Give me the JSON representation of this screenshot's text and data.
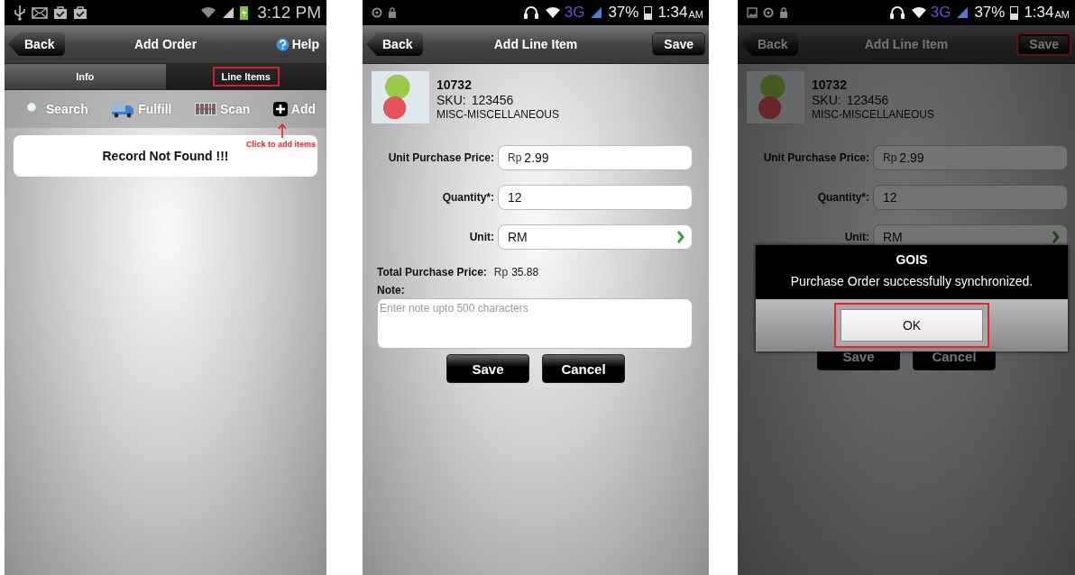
{
  "screens": [
    {
      "kind": "add_order",
      "status_bar": {
        "kind": "charging",
        "time": "3:12 PM"
      },
      "header": {
        "back": "Back",
        "title": "Add Order",
        "help": "Help"
      },
      "tabs": [
        {
          "label": "Info",
          "selected": false,
          "highlighted": false
        },
        {
          "label": "Line Items",
          "selected": true,
          "highlighted": true
        }
      ],
      "toolbar": [
        {
          "kind": "search",
          "label": "Search"
        },
        {
          "kind": "fulfill",
          "label": "Fulfill"
        },
        {
          "kind": "scan",
          "label": "Scan"
        },
        {
          "kind": "add",
          "label": "Add"
        }
      ],
      "annotation": "Click to add items",
      "message": "Record Not Found !!!"
    },
    {
      "kind": "line_item",
      "dimmed": false,
      "status_bar": {
        "kind": "headset",
        "network": "3G",
        "battery": "37%",
        "time": "1:34",
        "ampm": "AM"
      },
      "header": {
        "back": "Back",
        "title": "Add Line Item",
        "action": "Save",
        "action_highlighted": false
      },
      "product": {
        "code": "10732",
        "sku_label": "SKU:",
        "sku": "123456",
        "category": "MISC-MISCELLANEOUS"
      },
      "fields": [
        {
          "kind": "text",
          "label": "Unit Purchase Price:",
          "currency": "Rp",
          "value": "2.99"
        },
        {
          "kind": "text",
          "label": "Quantity*:",
          "value": "12"
        },
        {
          "kind": "select",
          "label": "Unit:",
          "value": "RM"
        }
      ],
      "total": {
        "label": "Total Purchase Price:",
        "currency": "Rp",
        "value": "35.88"
      },
      "note": {
        "label": "Note:",
        "placeholder": "Enter note upto 500 characters"
      },
      "buttons": [
        "Save",
        "Cancel"
      ]
    },
    {
      "kind": "line_item",
      "dimmed": true,
      "status_bar": {
        "kind": "headset_gallery",
        "network": "3G",
        "battery": "37%",
        "time": "1:34",
        "ampm": "AM"
      },
      "header": {
        "back": "Back",
        "title": "Add Line Item",
        "action": "Save",
        "action_highlighted": true
      },
      "product": {
        "code": "10732",
        "sku_label": "SKU:",
        "sku": "123456",
        "category": "MISC-MISCELLANEOUS"
      },
      "fields": [
        {
          "kind": "text",
          "label": "Unit Purchase Price:",
          "currency": "Rp",
          "value": "2.99"
        },
        {
          "kind": "text",
          "label": "Quantity*:",
          "value": "12"
        },
        {
          "kind": "select",
          "label": "Unit:",
          "value": "RM"
        }
      ],
      "buttons": [
        "Save",
        "Cancel"
      ],
      "dialog": {
        "title": "GOIS",
        "message": "Purchase Order successfully synchronized.",
        "button": "OK",
        "button_highlighted": true
      }
    }
  ]
}
